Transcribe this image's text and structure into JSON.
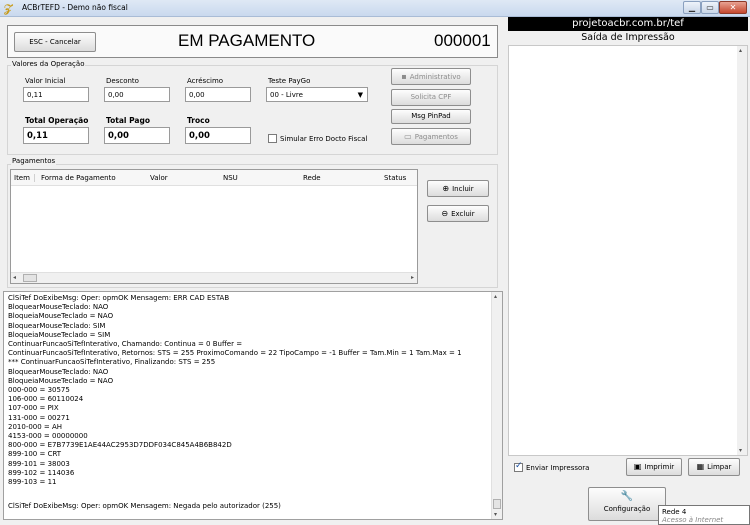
{
  "window": {
    "title": "ACBrTEFD - Demo não fiscal",
    "min_glyph": "▁",
    "max_glyph": "▭",
    "close_glyph": "✕"
  },
  "header": {
    "esc_button": "ESC - Cancelar",
    "status": "EM PAGAMENTO",
    "number": "000001"
  },
  "valores": {
    "caption": "Valores da Operação",
    "valor_inicial": {
      "label": "Valor Inicial",
      "value": "0,11"
    },
    "desconto": {
      "label": "Desconto",
      "value": "0,00"
    },
    "acrescimo": {
      "label": "Acréscimo",
      "value": "0,00"
    },
    "teste_paygo": {
      "label": "Teste PayGo",
      "selected": "00 - Livre"
    },
    "total_operacao": {
      "label": "Total Operação",
      "value": "0,11"
    },
    "total_pago": {
      "label": "Total Pago",
      "value": "0,00"
    },
    "troco": {
      "label": "Troco",
      "value": "0,00"
    },
    "simular": {
      "label": "Simular Erro Docto Fiscal",
      "checked": false
    },
    "buttons": {
      "administrativo": "Administrativo",
      "solicita_cpf": "Solicita CPF",
      "msg_pinpad": "Msg PinPad",
      "pagamentos": "Pagamentos"
    }
  },
  "pagamentos": {
    "caption": "Pagamentos",
    "columns": [
      "Item",
      "Forma de Pagamento",
      "Valor",
      "NSU",
      "Rede",
      "Status"
    ],
    "rows": [],
    "incluir": "Incluir",
    "excluir": "Excluir"
  },
  "log": {
    "lines": [
      "ClSiTef DoExibeMsg: Oper: opmOK Mensagem: ERR CAD ESTAB",
      "BloquearMouseTeclado: NAO",
      "BloqueiaMouseTeclado = NAO",
      "BloquearMouseTeclado: SIM",
      "BloqueiaMouseTeclado = SIM",
      "ContinuarFuncaoSiTefInterativo, Chamando: Continua = 0 Buffer =",
      "ContinuarFuncaoSiTefInterativo, Retornos: STS = 255 ProximoComando = 22 TipoCampo = -1 Buffer =  Tam.Min = 1 Tam.Max = 1",
      "*** ContinuarFuncaoSiTefInterativo, Finalizando: STS = 255",
      "BloquearMouseTeclado: NAO",
      "BloqueiaMouseTeclado = NAO",
      "000-000 = 30575",
      "106-000 = 60110024",
      "107-000 = PIX",
      "131-000 = 00271",
      "2010-000 = AH",
      "4153-000 = 00000000",
      "800-000 = E7B7739E1AE44AC2953D7DDF034C845A4B6B842D",
      "899-100 = CRT",
      "899-101 = 38003",
      "899-102 = 114036",
      "899-103 = 11"
    ],
    "last_line": "ClSiTef DoExibeMsg: Oper: opmOK Mensagem: Negada pelo autorizador (255)"
  },
  "impressao": {
    "site": "projetoacbr.com.br/tef",
    "title": "Saída de Impressão",
    "enviar_impressora": {
      "label": "Enviar Impressora",
      "checked": true
    },
    "imprimir": "Imprimir",
    "limpar": "Limpar",
    "configuracao": "Configuração"
  },
  "tooltip": {
    "line1": "Rede 4",
    "line2": "Acesso à Internet"
  }
}
